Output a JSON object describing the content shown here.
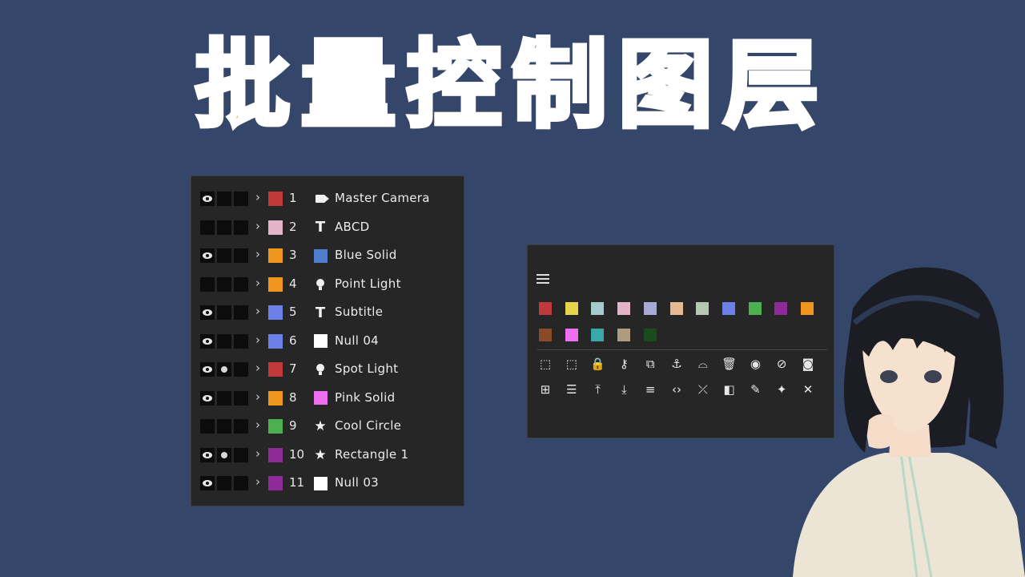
{
  "title": "批量控制图层",
  "layers": [
    {
      "visible": true,
      "solo": false,
      "num": "1",
      "label_color": "#c0393b",
      "type_icon": "camera-icon",
      "name": "Master Camera"
    },
    {
      "visible": false,
      "solo": false,
      "num": "2",
      "label_color": "#e3b4c8",
      "type_icon": "text-icon",
      "name": "ABCD"
    },
    {
      "visible": true,
      "solo": false,
      "num": "3",
      "label_color": "#f0951e",
      "type_icon": "solid-icon",
      "solid_color": "#4f7ccc",
      "name": "Blue Solid"
    },
    {
      "visible": false,
      "solo": false,
      "num": "4",
      "label_color": "#f0951e",
      "type_icon": "light-icon",
      "name": "Point Light"
    },
    {
      "visible": true,
      "solo": false,
      "num": "5",
      "label_color": "#6d80e8",
      "type_icon": "text-icon",
      "name": "Subtitle"
    },
    {
      "visible": true,
      "solo": false,
      "num": "6",
      "label_color": "#6d80e8",
      "type_icon": "solid-icon",
      "solid_color": "#ffffff",
      "name": "Null 04"
    },
    {
      "visible": true,
      "solo": true,
      "num": "7",
      "label_color": "#c0393b",
      "type_icon": "light-icon",
      "name": "Spot Light"
    },
    {
      "visible": true,
      "solo": false,
      "num": "8",
      "label_color": "#f0951e",
      "type_icon": "solid-icon",
      "solid_color": "#ee6ef0",
      "name": "Pink Solid"
    },
    {
      "visible": false,
      "solo": false,
      "num": "9",
      "label_color": "#4caf50",
      "type_icon": "star-icon",
      "name": "Cool Circle"
    },
    {
      "visible": true,
      "solo": true,
      "num": "10",
      "label_color": "#8e2b99",
      "type_icon": "star-icon",
      "name": "Rectangle 1"
    },
    {
      "visible": true,
      "solo": false,
      "num": "11",
      "label_color": "#8e2b99",
      "type_icon": "solid-icon",
      "solid_color": "#ffffff",
      "name": "Null 03"
    }
  ],
  "tools": {
    "label_colors": [
      "#c0393b",
      "#e5d54a",
      "#a5cbcc",
      "#e3b4c8",
      "#a9a9d6",
      "#e6b992",
      "#b3c9b0",
      "#6d80e8",
      "#4caf50",
      "#8e2b99",
      "#f0951e",
      "#8a4a2a",
      "#ee6ef0",
      "#3aa8a8",
      "#ad9c7e",
      "#1a4a1e"
    ],
    "buttons_row1": [
      {
        "name": "select-all-icon",
        "glyph": "⬚"
      },
      {
        "name": "deselect-icon",
        "glyph": "⬚"
      },
      {
        "name": "lock-icon",
        "glyph": "🔒"
      },
      {
        "name": "keyframe-icon",
        "glyph": "⚷"
      },
      {
        "name": "precompose-icon",
        "glyph": "⧉"
      },
      {
        "name": "anchor-icon",
        "glyph": "⚓"
      },
      {
        "name": "shy-icon",
        "glyph": "⌓"
      },
      {
        "name": "delete-icon",
        "glyph": "🗑"
      },
      {
        "name": "eye-icon",
        "glyph": "◉"
      },
      {
        "name": "eye-off-icon",
        "glyph": "⊘"
      },
      {
        "name": "solo-icon",
        "glyph": "◙"
      }
    ],
    "buttons_row2": [
      {
        "name": "add-layer-icon",
        "glyph": "⊞"
      },
      {
        "name": "list-icon",
        "glyph": "☰"
      },
      {
        "name": "move-top-icon",
        "glyph": "⤒"
      },
      {
        "name": "move-bottom-icon",
        "glyph": "⤓"
      },
      {
        "name": "align-icon",
        "glyph": "≡"
      },
      {
        "name": "code-icon",
        "glyph": "‹›"
      },
      {
        "name": "unlink-icon",
        "glyph": "⤫"
      },
      {
        "name": "fill-icon",
        "glyph": "◧"
      },
      {
        "name": "pen-icon",
        "glyph": "✎"
      },
      {
        "name": "magic-wand-icon",
        "glyph": "✦"
      },
      {
        "name": "cross-tools-icon",
        "glyph": "✕"
      }
    ]
  }
}
